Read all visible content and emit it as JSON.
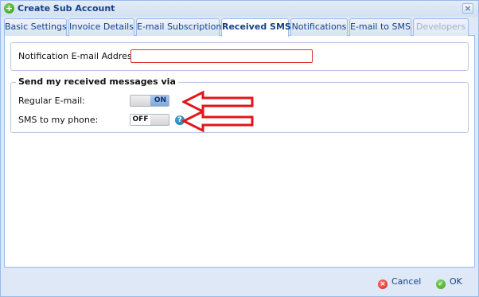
{
  "window": {
    "title": "Create Sub Account",
    "title_icon": "plus-icon",
    "close_icon": "close-icon"
  },
  "tabs": [
    {
      "label": "Basic Settings",
      "state": "normal"
    },
    {
      "label": "Invoice Details",
      "state": "normal"
    },
    {
      "label": "E-mail Subscription",
      "state": "normal"
    },
    {
      "label": "Received SMS",
      "state": "active"
    },
    {
      "label": "Notifications",
      "state": "normal"
    },
    {
      "label": "E-mail to SMS",
      "state": "normal"
    },
    {
      "label": "Developers",
      "state": "disabled"
    }
  ],
  "form": {
    "notification_email_label": "Notification E-mail Address:",
    "notification_email_value": "",
    "fieldset_legend": "Send my received messages via",
    "regular_email_label": "Regular E-mail:",
    "regular_email_toggle": "ON",
    "sms_phone_label": "SMS to my phone:",
    "sms_phone_toggle": "OFF",
    "help_icon": "?"
  },
  "footer": {
    "cancel_label": "Cancel",
    "ok_label": "OK"
  },
  "colors": {
    "accent": "#15428b",
    "border": "#99bbe8",
    "invalid_border": "#dd3333",
    "annotation_arrow": "#e3151a"
  }
}
